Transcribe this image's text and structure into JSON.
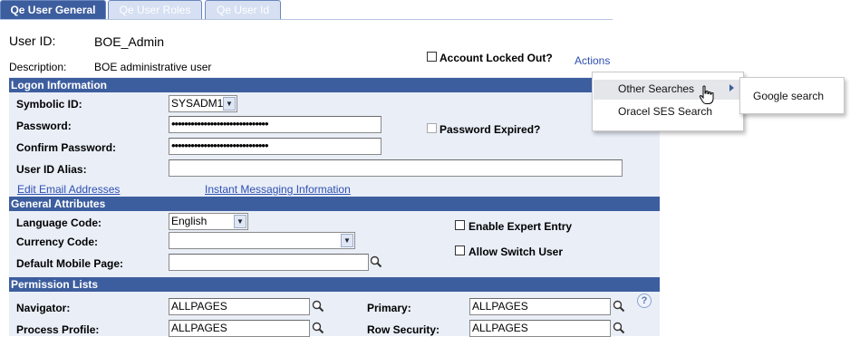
{
  "tabs": [
    {
      "label": "Qe User General"
    },
    {
      "label": "Qe User Roles"
    },
    {
      "label": "Qe User Id"
    }
  ],
  "header": {
    "user_id_label": "User ID:",
    "user_id_value": "BOE_Admin",
    "description_label": "Description:",
    "description_value": "BOE administrative user",
    "account_locked_label": "Account Locked Out?",
    "actions_label": "Actions"
  },
  "logon": {
    "title": "Logon Information",
    "symbolic_id_label": "Symbolic ID:",
    "symbolic_id_value": "SYSADM1",
    "password_label": "Password:",
    "password_value": "••••••••••••••••••••••••••••••",
    "confirm_password_label": "Confirm Password:",
    "confirm_password_value": "••••••••••••••••••••••••••••••",
    "password_expired_label": "Password Expired?",
    "user_id_alias_label": "User ID Alias:",
    "user_id_alias_value": "",
    "edit_email_link": "Edit Email Addresses",
    "instant_messaging_link": "Instant Messaging Information"
  },
  "general": {
    "title": "General Attributes",
    "language_code_label": "Language Code:",
    "language_code_value": "English",
    "currency_code_label": "Currency Code:",
    "currency_code_value": "",
    "default_mobile_page_label": "Default Mobile Page:",
    "default_mobile_page_value": "",
    "enable_expert_entry_label": "Enable Expert Entry",
    "allow_switch_user_label": "Allow Switch User"
  },
  "permissions": {
    "title": "Permission Lists",
    "navigator_label": "Navigator:",
    "navigator_value": "ALLPAGES",
    "primary_label": "Primary:",
    "primary_value": "ALLPAGES",
    "process_profile_label": "Process Profile:",
    "process_profile_value": "ALLPAGES",
    "row_security_label": "Row Security:",
    "row_security_value": "ALLPAGES",
    "help_glyph": "?"
  },
  "actions_menu": {
    "items": [
      {
        "label": "Other Searches"
      },
      {
        "label": "Oracel SES Search"
      }
    ],
    "submenu": [
      {
        "label": "Google search"
      }
    ]
  },
  "colors": {
    "header_blue": "#3d5e9e",
    "panel_bg": "#e9eef7",
    "link_blue": "#2f4fb2"
  }
}
